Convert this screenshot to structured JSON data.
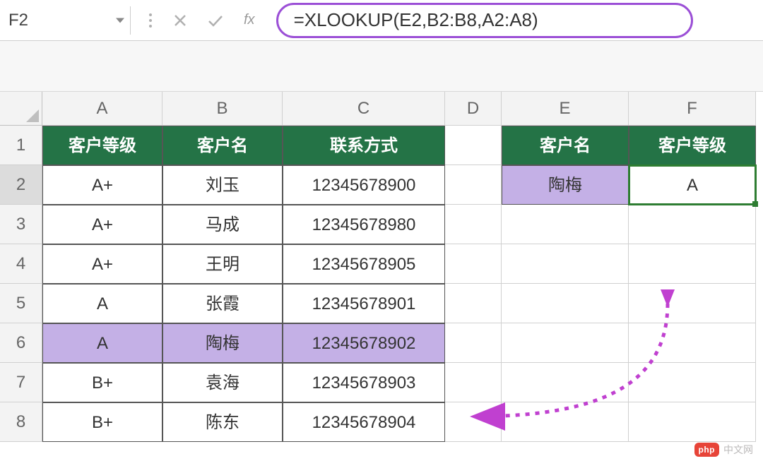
{
  "formula_bar": {
    "cell_ref": "F2",
    "formula": "=XLOOKUP(E2,B2:B8,A2:A8)"
  },
  "columns": [
    "A",
    "B",
    "C",
    "D",
    "E",
    "F"
  ],
  "rows": [
    "1",
    "2",
    "3",
    "4",
    "5",
    "6",
    "7",
    "8"
  ],
  "headers": {
    "A": "客户等级",
    "B": "客户名",
    "C": "联系方式",
    "E": "客户名",
    "F": "客户等级"
  },
  "table": [
    {
      "a": "A+",
      "b": "刘玉",
      "c": "12345678900"
    },
    {
      "a": "A+",
      "b": "马成",
      "c": "12345678980"
    },
    {
      "a": "A+",
      "b": "王明",
      "c": "12345678905"
    },
    {
      "a": "A",
      "b": "张霞",
      "c": "12345678901"
    },
    {
      "a": "A",
      "b": "陶梅",
      "c": "12345678902"
    },
    {
      "a": "B+",
      "b": "袁海",
      "c": "12345678903"
    },
    {
      "a": "B+",
      "b": "陈东",
      "c": "12345678904"
    }
  ],
  "lookup": {
    "e2": "陶梅",
    "f2": "A"
  },
  "watermark": {
    "logo": "php",
    "text": "中文网"
  }
}
